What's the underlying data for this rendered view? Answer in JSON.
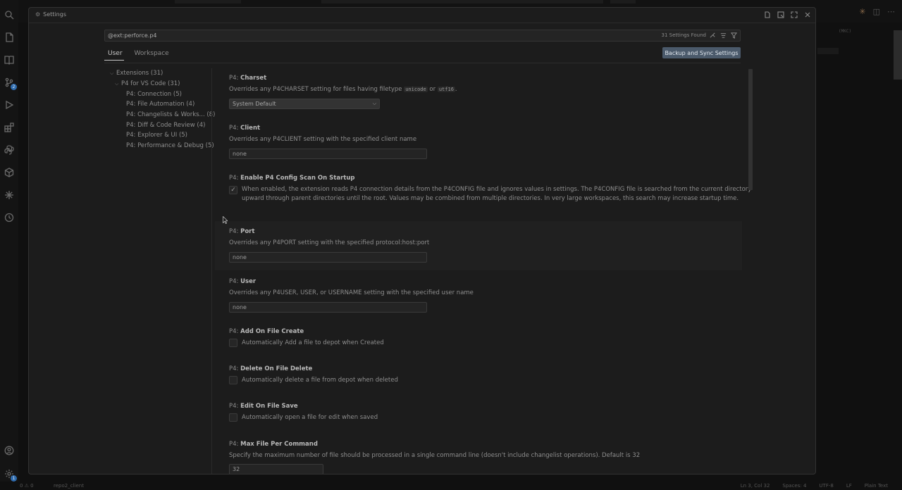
{
  "dialog": {
    "title": "Settings"
  },
  "search": {
    "value": "@ext:perforce.p4",
    "result_count": "31 Settings Found"
  },
  "scope_tabs": [
    {
      "label": "User",
      "active": true
    },
    {
      "label": "Workspace",
      "active": false
    }
  ],
  "sync_button_label": "Backup and Sync Settings",
  "toc": [
    {
      "label": "Extensions (31)",
      "level": 0,
      "expanded": true
    },
    {
      "label": "P4 for VS Code (31)",
      "level": 1,
      "expanded": true
    },
    {
      "label": "P4: Connection (5)",
      "level": 2
    },
    {
      "label": "P4: File Automation (4)",
      "level": 2
    },
    {
      "label": "P4: Changelists & Works... (8)",
      "level": 2
    },
    {
      "label": "P4: Diff & Code Review (4)",
      "level": 2
    },
    {
      "label": "P4: Explorer & UI (5)",
      "level": 2
    },
    {
      "label": "P4: Performance & Debug (5)",
      "level": 2
    }
  ],
  "settings": {
    "charset": {
      "category": "P4: ",
      "name": "Charset",
      "desc_before": "Overrides any P4CHARSET setting for files having filetype ",
      "code1": "unicode",
      "desc_mid": " or ",
      "code2": "utf16",
      "desc_after": ".",
      "value": "System Default"
    },
    "client": {
      "category": "P4: ",
      "name": "Client",
      "desc": "Overrides any P4CLIENT setting with the specified client name",
      "value": "none"
    },
    "config_scan": {
      "category": "P4: ",
      "name": "Enable P4 Config Scan On Startup",
      "checked": true,
      "desc_line1": "When enabled, the extension reads P4 connection details from the P4CONFIG file and ignores values in settings. The P4CONFIG file is searched from the current directory",
      "desc_line2": "upward through parent directories until the root. Values may be combined from multiple directories. In very large workspaces, this search may increase startup time."
    },
    "port": {
      "category": "P4: ",
      "name": "Port",
      "desc": "Overrides any P4PORT setting with the specified protocol:host:port",
      "value": "none"
    },
    "user": {
      "category": "P4: ",
      "name": "User",
      "desc": "Overrides any P4USER, USER, or USERNAME setting with the specified user name",
      "value": "none"
    },
    "add_on_create": {
      "category": "P4: ",
      "name": "Add On File Create",
      "checked": false,
      "desc": "Automatically Add a file to depot when Created"
    },
    "delete_on_delete": {
      "category": "P4: ",
      "name": "Delete On File Delete",
      "checked": false,
      "desc": "Automatically delete a file from depot when deleted"
    },
    "edit_on_save": {
      "category": "P4: ",
      "name": "Edit On File Save",
      "checked": false,
      "desc": "Automatically open a file for edit when saved"
    },
    "max_file": {
      "category": "P4: ",
      "name": "Max File Per Command",
      "desc": "Specify the maximum number of file should be processed in a single command line (doesn't include changelist operations). Default is 32",
      "value": "32"
    }
  },
  "activity_badges": {
    "source_control": "2",
    "accounts": "1"
  },
  "editor_bg_text": "(MKC)",
  "status_bar": {
    "problems": "0 ⚠ 0",
    "branch": "repo2_client",
    "position": "Ln 3, Col 32",
    "spaces": "Spaces: 4",
    "encoding": "UTF-8",
    "eol": "LF",
    "language": "Plain Text"
  }
}
